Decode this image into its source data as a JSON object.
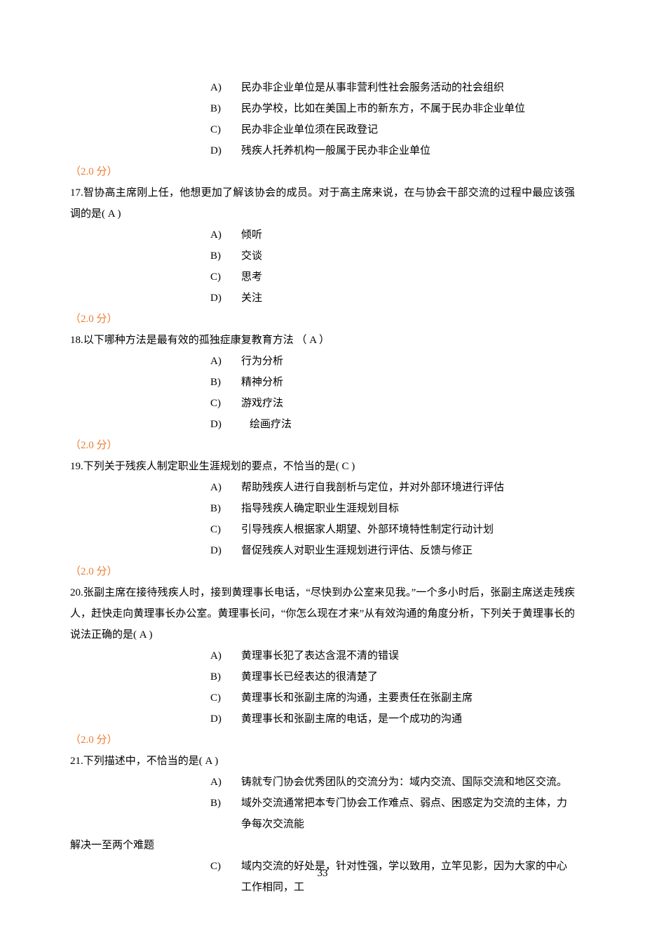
{
  "q16": {
    "options": {
      "A": {
        "label": "A)",
        "text": "民办非企业单位是从事非营利性社会服务活动的社会组织"
      },
      "B": {
        "label": "B)",
        "text": "民办学校，比如在美国上市的新东方，不属于民办非企业单位"
      },
      "C": {
        "label": "C)",
        "text": "民办非企业单位须在民政登记"
      },
      "D": {
        "label": "D)",
        "text": "残疾人托养机构一般属于民办非企业单位"
      }
    },
    "score": "（2.0 分）"
  },
  "q17": {
    "stem": "17.智协高主席刚上任，他想更加了解该协会的成员。对于高主席来说，在与协会干部交流的过程中最应该强调的是(   A   )",
    "options": {
      "A": {
        "label": "A)",
        "text": "倾听"
      },
      "B": {
        "label": "B)",
        "text": "交谈"
      },
      "C": {
        "label": "C)",
        "text": "思考"
      },
      "D": {
        "label": "D)",
        "text": "关注"
      }
    },
    "score": "（2.0 分）"
  },
  "q18": {
    "stem": "18.以下哪种方法是最有效的孤独症康复教育方法  （   A   ）",
    "options": {
      "A": {
        "label": "A)",
        "text": "行为分析"
      },
      "B": {
        "label": "B)",
        "text": "精神分析"
      },
      "C": {
        "label": "C)",
        "text": "游戏疗法"
      },
      "D": {
        "label": "D)",
        "text": "绘画疗法"
      }
    },
    "score": "（2.0 分）"
  },
  "q19": {
    "stem": "19.下列关于残疾人制定职业生涯规划的要点，不恰当的是(   C   )",
    "options": {
      "A": {
        "label": "A)",
        "text": "帮助残疾人进行自我剖析与定位，并对外部环境进行评估"
      },
      "B": {
        "label": "B)",
        "text": "指导残疾人确定职业生涯规划目标"
      },
      "C": {
        "label": "C)",
        "text": "引导残疾人根据家人期望、外部环境特性制定行动计划"
      },
      "D": {
        "label": "D)",
        "text": "督促残疾人对职业生涯规划进行评估、反馈与修正"
      }
    },
    "score": "（2.0 分）"
  },
  "q20": {
    "stem": "20.张副主席在接待残疾人时，接到黄理事长电话，“尽快到办公室来见我。”一个多小时后，张副主席送走残疾人，赶快走向黄理事长办公室。黄理事长问，“你怎么现在才来”从有效沟通的角度分析，下列关于黄理事长的说法正确的是(   A   )",
    "options": {
      "A": {
        "label": "A)",
        "text": "黄理事长犯了表达含混不清的错误"
      },
      "B": {
        "label": "B)",
        "text": "黄理事长已经表达的很清楚了"
      },
      "C": {
        "label": "C)",
        "text": "黄理事长和张副主席的沟通，主要责任在张副主席"
      },
      "D": {
        "label": "D)",
        "text": "黄理事长和张副主席的电话，是一个成功的沟通"
      }
    },
    "score": "（2.0 分）"
  },
  "q21": {
    "stem": "21.下列描述中，不恰当的是( A     )",
    "options": {
      "A": {
        "label": "A)",
        "text": "铸就专门协会优秀团队的交流分为：域内交流、国际交流和地区交流。"
      },
      "B": {
        "label": "B)",
        "text": "域外交流通常把本专门协会工作难点、弱点、困惑定为交流的主体，力争每次交流能"
      },
      "B_wrap": "解决一至两个难题",
      "C": {
        "label": "C)",
        "text": "域内交流的好处是，针对性强，学以致用，立竿见影，因为大家的中心工作相同，工"
      }
    }
  },
  "pageNumber": "33"
}
